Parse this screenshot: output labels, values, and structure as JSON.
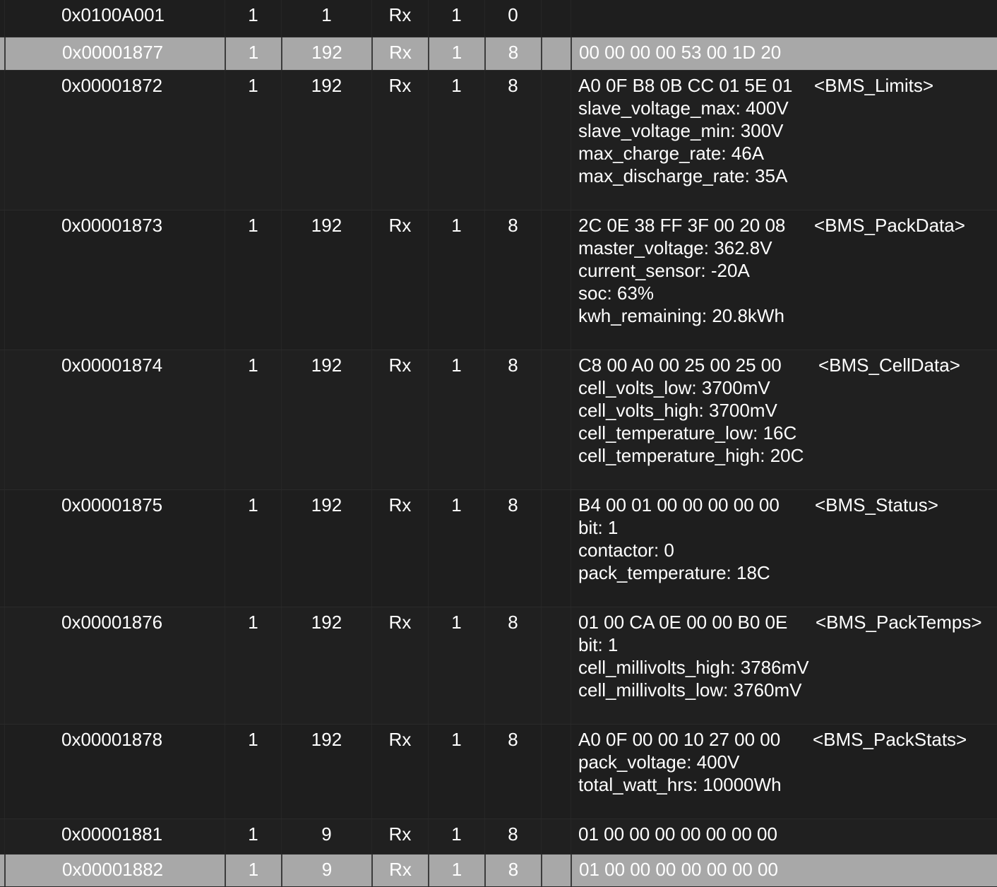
{
  "rows": [
    {
      "id": "0x0100A001",
      "a": "1",
      "b": "1",
      "dir": "Rx",
      "c": "1",
      "len": "0",
      "data": "",
      "msg": "",
      "signals": []
    },
    {
      "id": "0x00001877",
      "a": "1",
      "b": "192",
      "dir": "Rx",
      "c": "1",
      "len": "8",
      "data": "00 00 00 00 53 00 1D 20",
      "msg": "",
      "signals": []
    },
    {
      "id": "0x00001872",
      "a": "1",
      "b": "192",
      "dir": "Rx",
      "c": "1",
      "len": "8",
      "data": "A0 0F B8 0B CC 01 5E 01",
      "msg": "<BMS_Limits>",
      "signals": [
        "slave_voltage_max: 400V",
        "slave_voltage_min: 300V",
        "max_charge_rate: 46A",
        "max_discharge_rate: 35A"
      ]
    },
    {
      "id": "0x00001873",
      "a": "1",
      "b": "192",
      "dir": "Rx",
      "c": "1",
      "len": "8",
      "data": "2C 0E 38 FF 3F 00 20 08",
      "msg": "<BMS_PackData>",
      "signals": [
        "master_voltage: 362.8V",
        "current_sensor: -20A",
        "soc: 63%",
        "kwh_remaining: 20.8kWh"
      ]
    },
    {
      "id": "0x00001874",
      "a": "1",
      "b": "192",
      "dir": "Rx",
      "c": "1",
      "len": "8",
      "data": "C8 00 A0 00 25 00 25 00",
      "msg": "<BMS_CellData>",
      "signals": [
        "cell_volts_low: 3700mV",
        "cell_volts_high: 3700mV",
        "cell_temperature_low: 16C",
        "cell_temperature_high: 20C"
      ]
    },
    {
      "id": "0x00001875",
      "a": "1",
      "b": "192",
      "dir": "Rx",
      "c": "1",
      "len": "8",
      "data": "B4 00 01 00 00 00 00 00",
      "msg": "<BMS_Status>",
      "signals": [
        "bit: 1",
        "contactor: 0",
        "pack_temperature: 18C"
      ]
    },
    {
      "id": "0x00001876",
      "a": "1",
      "b": "192",
      "dir": "Rx",
      "c": "1",
      "len": "8",
      "data": "01 00 CA 0E 00 00 B0 0E",
      "msg": "<BMS_PackTemps>",
      "signals": [
        "bit: 1",
        "cell_millivolts_high: 3786mV",
        "cell_millivolts_low: 3760mV"
      ]
    },
    {
      "id": "0x00001878",
      "a": "1",
      "b": "192",
      "dir": "Rx",
      "c": "1",
      "len": "8",
      "data": "A0 0F 00 00 10 27 00 00",
      "msg": "<BMS_PackStats>",
      "signals": [
        "pack_voltage: 400V",
        "total_watt_hrs: 10000Wh"
      ]
    },
    {
      "id": "0x00001881",
      "a": "1",
      "b": "9",
      "dir": "Rx",
      "c": "1",
      "len": "8",
      "data": "01 00 00 00 00 00 00 00",
      "msg": "",
      "signals": []
    },
    {
      "id": "0x00001882",
      "a": "1",
      "b": "9",
      "dir": "Rx",
      "c": "1",
      "len": "8",
      "data": "01 00 00 00 00 00 00 00",
      "msg": "",
      "signals": []
    }
  ]
}
